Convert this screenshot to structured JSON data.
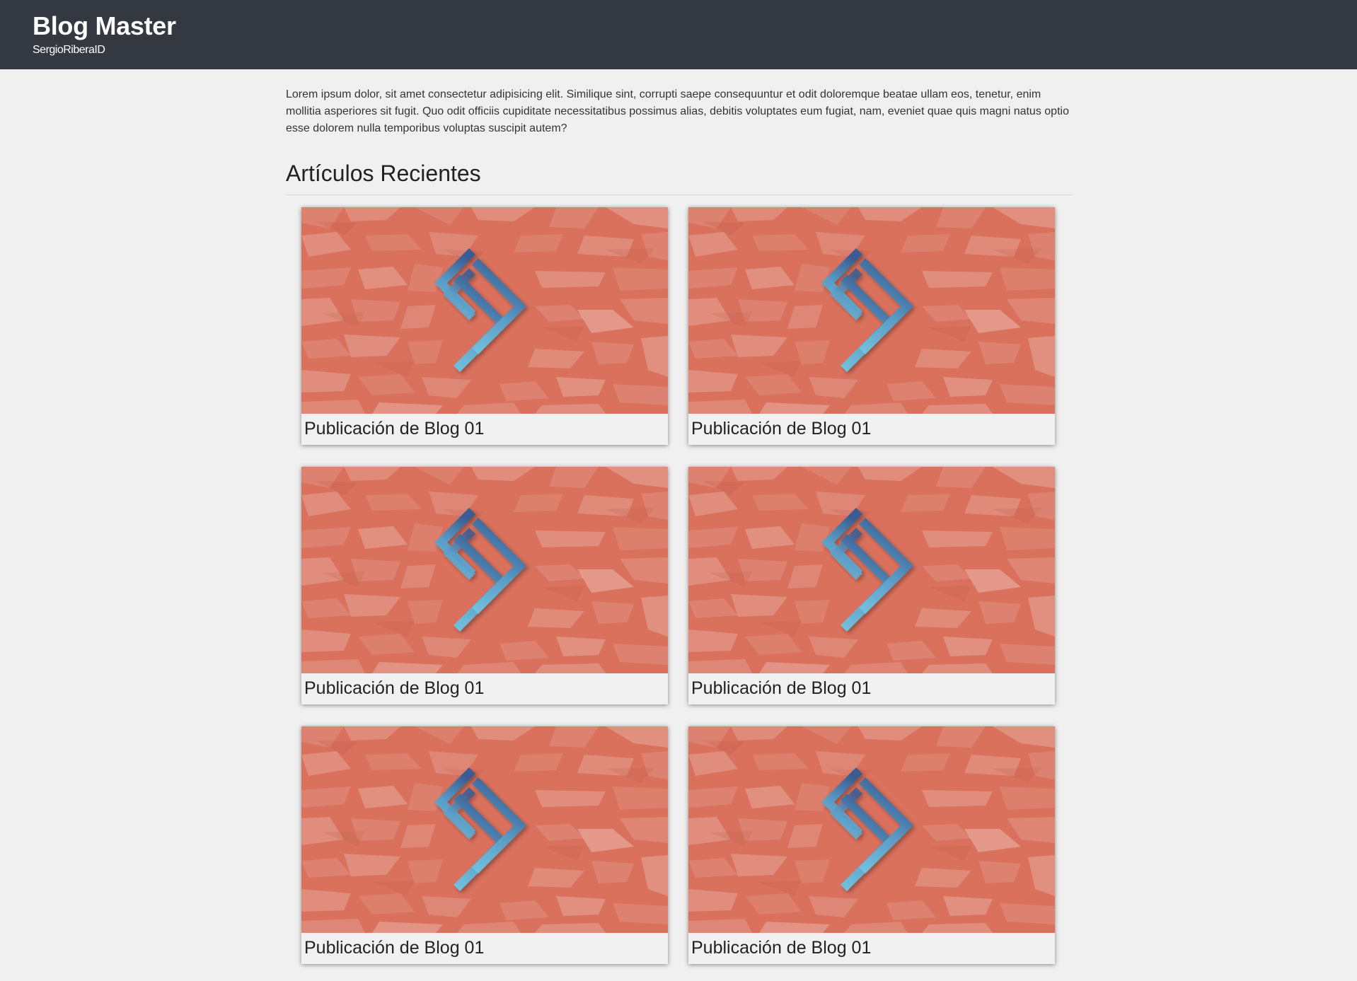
{
  "header": {
    "title": "Blog Master",
    "subtitle": "SergioRiberaID"
  },
  "intro": {
    "text": "Lorem ipsum dolor, sit amet consectetur adipisicing elit. Similique sint, corrupti saepe consequuntur et odit doloremque beatae ullam eos, tenetur, enim mollitia asperiores sit fugit. Quo odit officiis cupiditate necessitatibus possimus alias, debitis voluptates eum fugiat, nam, eveniet quae quis magni natus optio esse dolorem nulla temporibus voluptas suscipit autem?"
  },
  "recent": {
    "title": "Artículos Recientes",
    "posts": [
      {
        "title": "Publicación de Blog 01"
      },
      {
        "title": "Publicación de Blog 01"
      },
      {
        "title": "Publicación de Blog 01"
      },
      {
        "title": "Publicación de Blog 01"
      },
      {
        "title": "Publicación de Blog 01"
      },
      {
        "title": "Publicación de Blog 01"
      }
    ]
  },
  "colors": {
    "header_bg": "#343840",
    "page_bg": "#f0f0f0",
    "thumb_bg": "#d9715d",
    "logo_dark": "#3b5f95",
    "logo_light": "#6fbfdd"
  },
  "icons": {
    "thumbnail_logo": "chevron-logo-icon"
  }
}
